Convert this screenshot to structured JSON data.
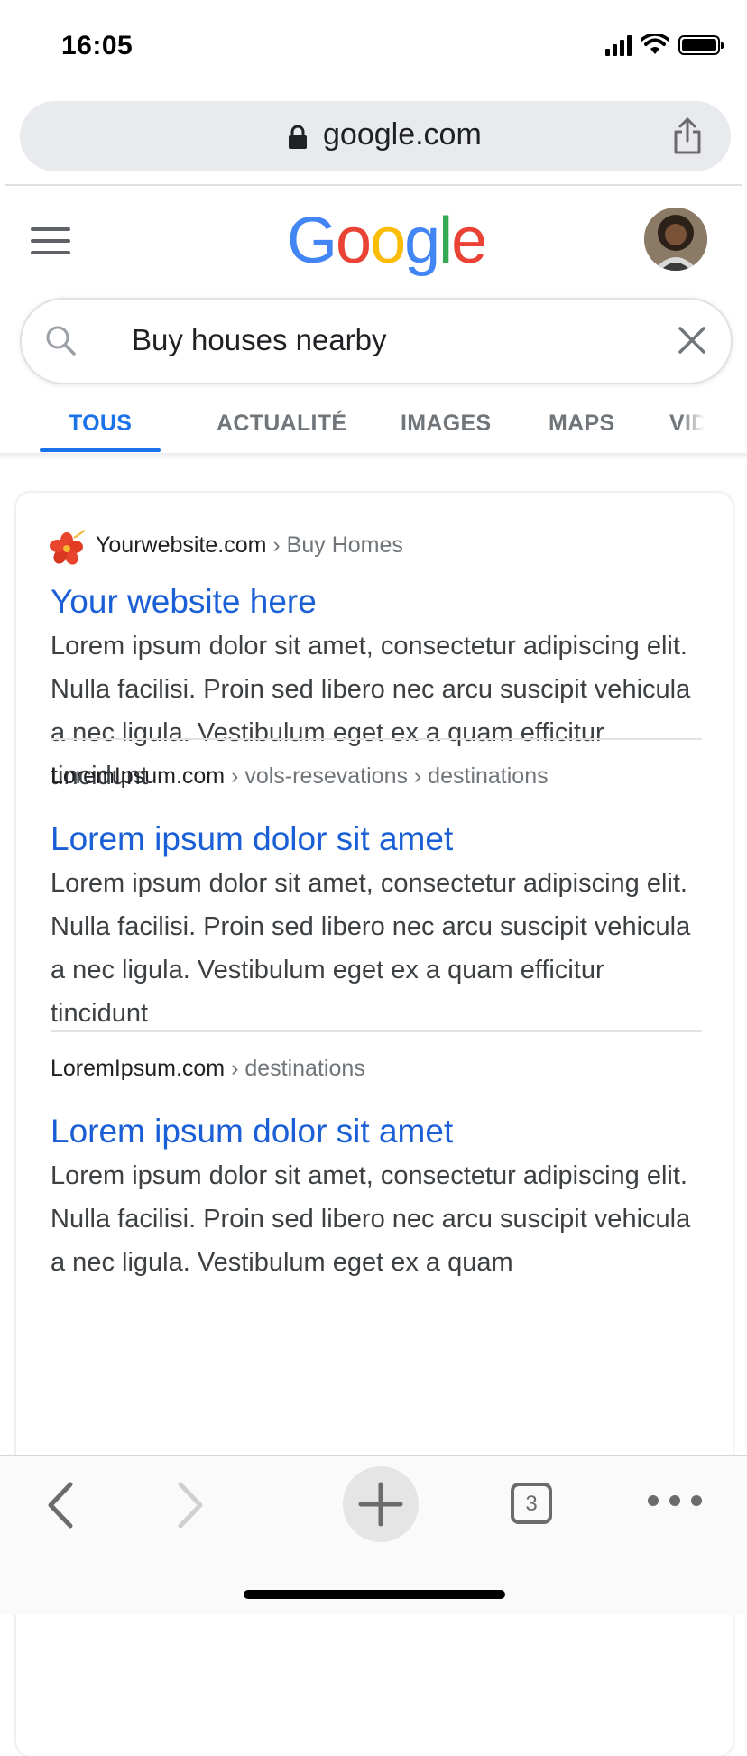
{
  "status_bar": {
    "time": "16:05"
  },
  "browser": {
    "url": "google.com"
  },
  "header": {
    "logo_letters": [
      "G",
      "o",
      "o",
      "g",
      "l",
      "e"
    ],
    "logo_colors": [
      "#4285F4",
      "#EA4335",
      "#FBBC05",
      "#4285F4",
      "#34A853",
      "#EA4335"
    ]
  },
  "search": {
    "query": "Buy houses nearby"
  },
  "tabs": [
    {
      "label": "TOUS",
      "active": true
    },
    {
      "label": "ACTUALITÉ",
      "active": false
    },
    {
      "label": "IMAGES",
      "active": false
    },
    {
      "label": "MAPS",
      "active": false
    },
    {
      "label": "VID",
      "active": false
    }
  ],
  "results": [
    {
      "site": "Yourwebsite.com",
      "path": " › Buy Homes",
      "title": "Your website here",
      "snippet": "Lorem ipsum dolor sit amet, consectetur adipiscing elit. Nulla facilisi. Proin sed libero nec arcu suscipit vehicula a nec ligula. Vestibulum eget ex a quam efficitur tincidunt"
    },
    {
      "site": "LoremIpsum.com",
      "path": " › vols-resevations › destinations",
      "title": "Lorem ipsum dolor sit amet",
      "snippet": "Lorem ipsum dolor sit amet, consectetur adipiscing elit. Nulla facilisi. Proin sed libero nec arcu suscipit vehicula a nec ligula. Vestibulum eget ex a quam efficitur tincidunt"
    },
    {
      "site": "LoremIpsum.com",
      "path": " › destinations",
      "title": "Lorem ipsum dolor sit amet",
      "snippet": "Lorem ipsum dolor sit amet, consectetur adipiscing elit. Nulla facilisi. Proin sed libero nec arcu suscipit vehicula a nec ligula. Vestibulum eget ex a quam"
    }
  ],
  "toolbar": {
    "tab_count": "3"
  },
  "colors": {
    "accent": "#1a73e8",
    "link": "#1a5fd6"
  }
}
